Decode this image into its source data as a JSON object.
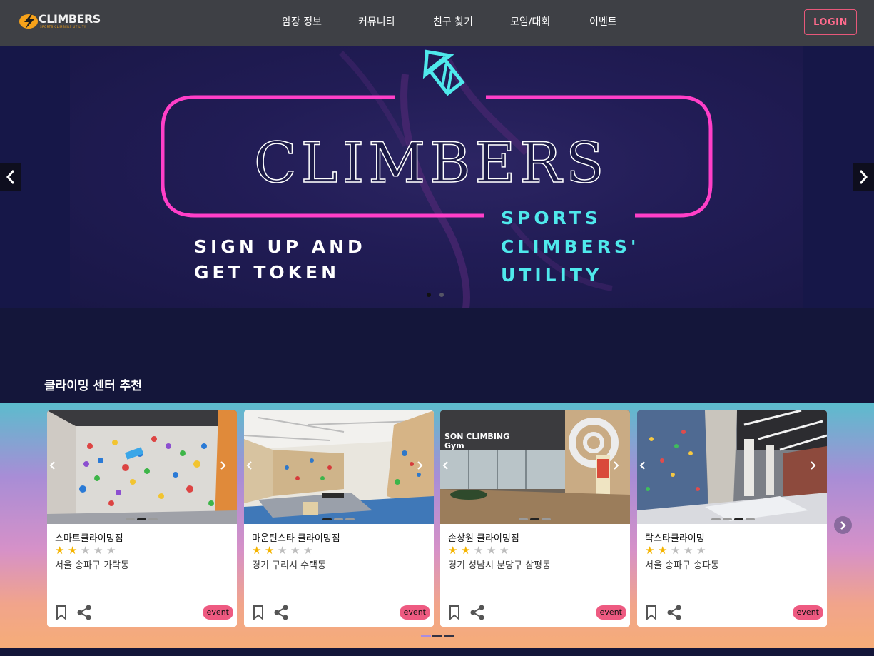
{
  "header": {
    "logo_text": "CLIMBERS",
    "logo_sub": "SPORTS CLIMBERS UTILITY",
    "nav": [
      "암장 정보",
      "커뮤니티",
      "친구 찾기",
      "모임/대회",
      "이벤트"
    ],
    "login": "LOGIN"
  },
  "hero": {
    "title": "CLIMBERS",
    "left_line1": "SIGN UP AND",
    "left_line2": "GET TOKEN",
    "right_line1": "SPORTS",
    "right_line2": "CLIMBERS'",
    "right_line3": "UTILITY",
    "slides": 2,
    "active_slide": 1,
    "prev_icon": "chevron-left-icon",
    "next_icon": "chevron-right-icon"
  },
  "section": {
    "title": "클라이밍 센터 추천",
    "pages": 3,
    "active_page": 1
  },
  "cards": [
    {
      "name": "스마트클라이밍짐",
      "rating": 2,
      "max_rating": 5,
      "location": "서울 송파구 가락동",
      "badge": "event",
      "image_slides": 3,
      "active_image": 2
    },
    {
      "name": "마운틴스타 클라이밍짐",
      "rating": 2,
      "max_rating": 5,
      "location": "경기 구리시 수택동",
      "badge": "event",
      "image_slides": 3,
      "active_image": 1
    },
    {
      "name": "손상원 클라이밍짐",
      "rating": 2,
      "max_rating": 5,
      "location": "경기 성남시 분당구 삼평동",
      "badge": "event",
      "image_slides": 3,
      "active_image": 2,
      "image_sign": "SON CLIMBING Gym"
    },
    {
      "name": "락스타클라이밍",
      "rating": 2,
      "max_rating": 5,
      "location": "서울 송파구 송파동",
      "badge": "event",
      "image_slides": 4,
      "active_image": 3
    }
  ],
  "colors": {
    "header_bg": "#3e4045",
    "page_bg": "#14163a",
    "accent_pink": "#ff3fc8",
    "accent_cyan": "#4fe9ec",
    "star": "#f5b400",
    "badge": "#ee5a81",
    "login": "#ff6b8d"
  }
}
